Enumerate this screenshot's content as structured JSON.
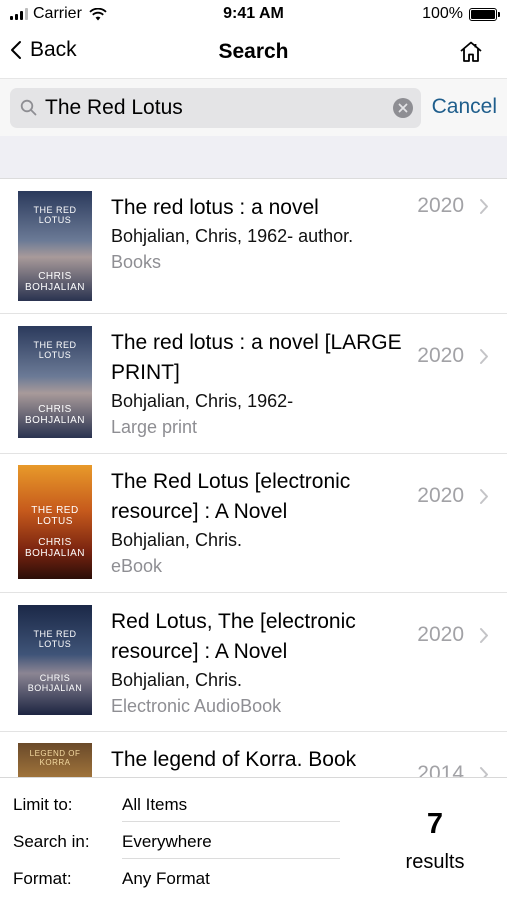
{
  "status": {
    "carrier": "Carrier",
    "time": "9:41 AM",
    "battery": "100%"
  },
  "nav": {
    "back_label": "Back",
    "title": "Search"
  },
  "search": {
    "value": "The Red Lotus",
    "cancel_label": "Cancel"
  },
  "results": [
    {
      "title": "The red lotus : a novel",
      "author": "Bohjalian, Chris, 1962- author.",
      "format": "Books",
      "year": "2020",
      "cover_top": "THE RED LOTUS",
      "cover_bottom": "CHRIS BOHJALIAN"
    },
    {
      "title": "The red lotus : a novel [LARGE PRINT]",
      "author": "Bohjalian, Chris, 1962-",
      "format": "Large print",
      "year": "2020",
      "cover_top": "THE RED LOTUS",
      "cover_bottom": "CHRIS BOHJALIAN"
    },
    {
      "title": "The Red Lotus [electronic resource] : A Novel",
      "author": "Bohjalian, Chris.",
      "format": "eBook",
      "year": "2020",
      "cover_top": "THE RED LOTUS",
      "cover_bottom": "CHRIS BOHJALIAN"
    },
    {
      "title": "Red Lotus, The [electronic resource] : A Novel",
      "author": "Bohjalian, Chris.",
      "format": "Electronic AudioBook",
      "year": "2020",
      "cover_top": "THE RED LOTUS",
      "cover_bottom": "CHRIS BOHJALIAN"
    },
    {
      "title": "The legend of Korra. Book",
      "author": "",
      "format": "",
      "year": "2014",
      "cover_top": "LEGEND OF KORRA",
      "cover_bottom": ""
    }
  ],
  "footer": {
    "limit_label": "Limit to:",
    "limit_value": "All Items",
    "search_in_label": "Search in:",
    "search_in_value": "Everywhere",
    "format_label": "Format:",
    "format_value": "Any Format",
    "count": "7",
    "count_label": "results"
  }
}
